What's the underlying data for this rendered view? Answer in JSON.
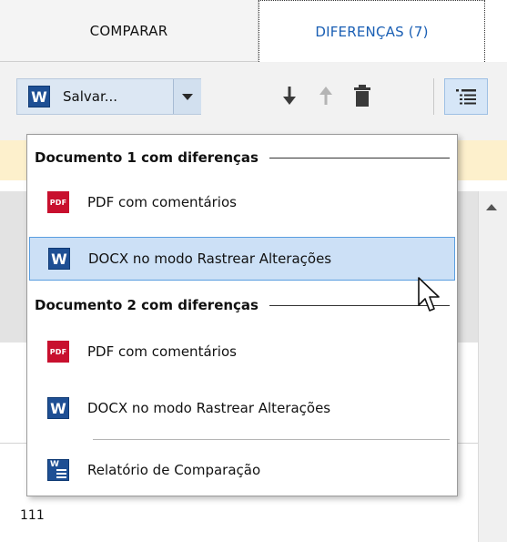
{
  "tabs": {
    "compare_label": "COMPARAR",
    "differences_label": "DIFERENÇAS (7)"
  },
  "toolbar": {
    "save_icon": "word-icon",
    "save_icon_letter": "W",
    "save_label": "Salvar...",
    "actions": [
      "arrow-down-icon",
      "arrow-up-icon",
      "trash-icon",
      "list-view-icon"
    ]
  },
  "background": {
    "bottom_number": "111"
  },
  "dropdown": {
    "section1_label": "Documento 1 com diferenças",
    "section2_label": "Documento 2 com diferenças",
    "items": [
      {
        "icon": "pdf-icon",
        "icon_text": "PDF",
        "label": "PDF com comentários"
      },
      {
        "icon": "word-icon",
        "icon_text": "W",
        "label": "DOCX no modo Rastrear Alterações",
        "highlighted": true
      },
      {
        "icon": "pdf-icon",
        "icon_text": "PDF",
        "label": "PDF com comentários"
      },
      {
        "icon": "word-icon",
        "icon_text": "W",
        "label": "DOCX no modo Rastrear Alterações"
      },
      {
        "icon": "report-icon",
        "icon_text": "W",
        "label": "Relatório de Comparação"
      }
    ]
  },
  "colors": {
    "accent_blue": "#1a5fb4",
    "pdf_red": "#c8102e",
    "word_blue": "#1e4f94",
    "highlight": "#cce0f6",
    "info_strip": "#fdf0cc"
  }
}
